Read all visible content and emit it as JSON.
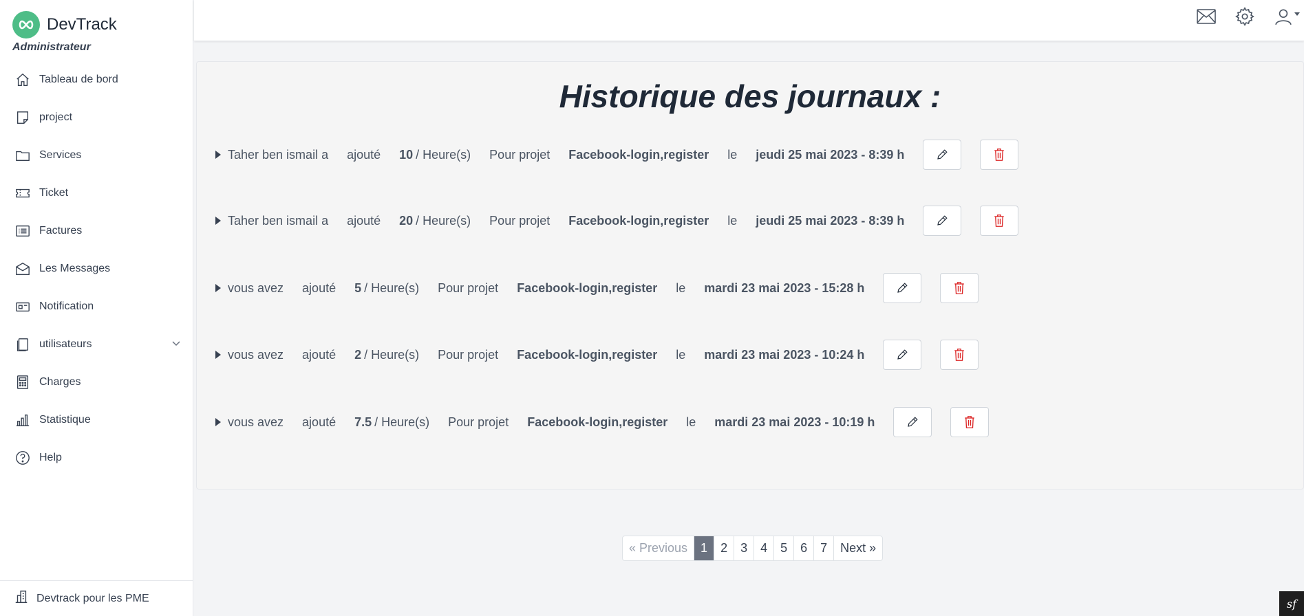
{
  "brand": {
    "name": "DevTrack",
    "role": "Administrateur",
    "color": "#4ebd87"
  },
  "sidebar": {
    "items": [
      {
        "label": "Tableau de bord",
        "icon": "home-icon"
      },
      {
        "label": "project",
        "icon": "note-icon"
      },
      {
        "label": "Services",
        "icon": "folder-icon"
      },
      {
        "label": "Ticket",
        "icon": "ticket-icon"
      },
      {
        "label": "Factures",
        "icon": "list-icon"
      },
      {
        "label": "Les Messages",
        "icon": "envelope-open-icon"
      },
      {
        "label": "Notification",
        "icon": "notification-icon"
      },
      {
        "label": "utilisateurs",
        "icon": "copy-icon"
      },
      {
        "label": "Charges",
        "icon": "calculator-icon"
      },
      {
        "label": "Statistique",
        "icon": "bar-chart-icon"
      },
      {
        "label": "Help",
        "icon": "help-icon"
      }
    ],
    "footer": {
      "label": "Devtrack pour les PME",
      "icon": "building-icon"
    }
  },
  "topbar": {
    "icons": [
      "mail-icon",
      "gear-icon",
      "user-icon"
    ]
  },
  "main": {
    "title": "Historique des journaux :",
    "entries": [
      {
        "who": "Taher ben ismail a",
        "action": "ajouté",
        "hours": "10",
        "unit": "/ Heure(s)",
        "project_label": "Pour projet",
        "project": "Facebook-login,register",
        "le": "le",
        "date": "jeudi 25 mai 2023 - 8:39 h"
      },
      {
        "who": "Taher ben ismail a",
        "action": "ajouté",
        "hours": "20",
        "unit": "/ Heure(s)",
        "project_label": "Pour projet",
        "project": "Facebook-login,register",
        "le": "le",
        "date": "jeudi 25 mai 2023 - 8:39 h"
      },
      {
        "who": "vous avez",
        "action": "ajouté",
        "hours": "5",
        "unit": "/ Heure(s)",
        "project_label": "Pour projet",
        "project": "Facebook-login,register",
        "le": "le",
        "date": "mardi 23 mai 2023 - 15:28 h"
      },
      {
        "who": "vous avez",
        "action": "ajouté",
        "hours": "2",
        "unit": "/ Heure(s)",
        "project_label": "Pour projet",
        "project": "Facebook-login,register",
        "le": "le",
        "date": "mardi 23 mai 2023 - 10:24 h"
      },
      {
        "who": "vous avez",
        "action": "ajouté",
        "hours": "7.5",
        "unit": "/ Heure(s)",
        "project_label": "Pour projet",
        "project": "Facebook-login,register",
        "le": "le",
        "date": "mardi 23 mai 2023 - 10:19 h"
      }
    ]
  },
  "pagination": {
    "previous": "« Previous",
    "pages": [
      "1",
      "2",
      "3",
      "4",
      "5",
      "6",
      "7"
    ],
    "current": "1",
    "next": "Next »"
  },
  "colors": {
    "delete": "#dc2626",
    "active_page": "#6b7280"
  },
  "badge": {
    "label": "sf"
  }
}
